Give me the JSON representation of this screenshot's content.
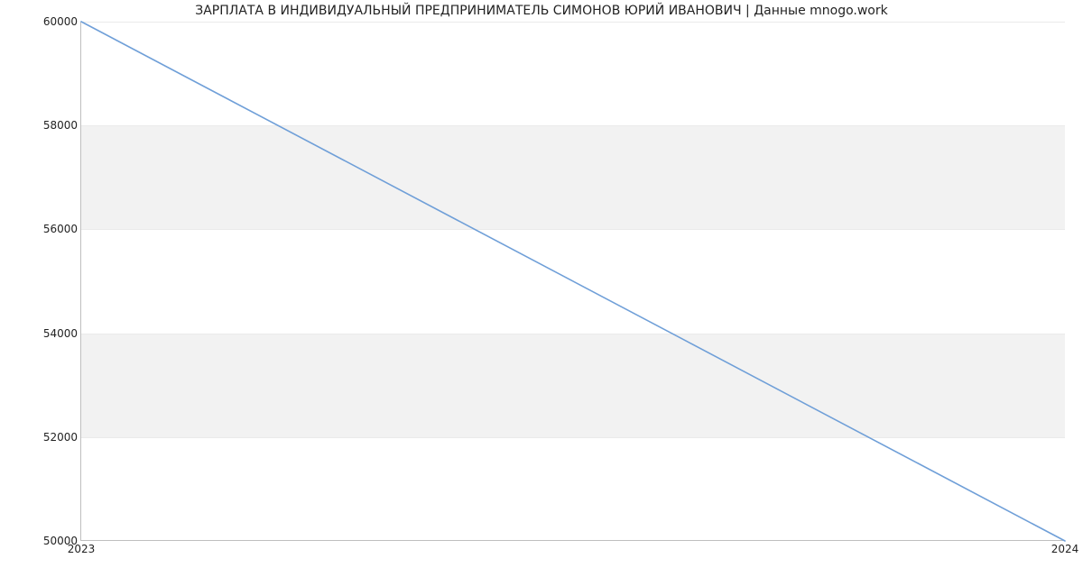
{
  "chart_data": {
    "type": "line",
    "title": "ЗАРПЛАТА В ИНДИВИДУАЛЬНЫЙ ПРЕДПРИНИМАТЕЛЬ СИМОНОВ ЮРИЙ ИВАНОВИЧ | Данные mnogo.work",
    "x": [
      "2023",
      "2024"
    ],
    "values": [
      60000,
      50000
    ],
    "xlabel": "",
    "ylabel": "",
    "xlim": [
      "2023",
      "2024"
    ],
    "ylim": [
      50000,
      60000
    ],
    "y_ticks": [
      50000,
      52000,
      54000,
      56000,
      58000,
      60000
    ],
    "x_ticks": [
      "2023",
      "2024"
    ],
    "line_color": "#6f9fd8",
    "band_color": "#f2f2f2",
    "grid": true
  }
}
